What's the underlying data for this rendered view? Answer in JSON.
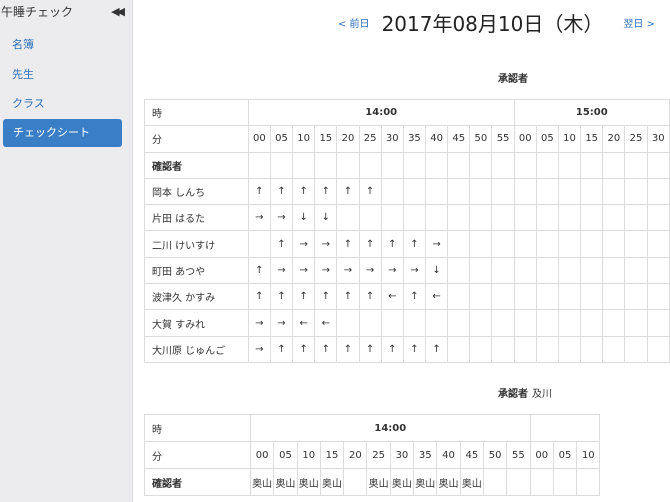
{
  "app": {
    "title": "午睡チェック"
  },
  "nav": [
    {
      "label": "名簿"
    },
    {
      "label": "先生"
    },
    {
      "label": "クラス"
    },
    {
      "label": "チェックシート",
      "active": true
    }
  ],
  "date_nav": {
    "prev": "< 前日",
    "title": "2017年08月10日（木）",
    "next": "翌日 >"
  },
  "sheets": [
    {
      "approver_label": "承認者",
      "approver_name": "",
      "row_label_time": "時",
      "row_label_minute": "分",
      "row_label_confirmer": "確認者",
      "hours": [
        "14:00",
        "15:00"
      ],
      "minutes": [
        "00",
        "05",
        "10",
        "15",
        "20",
        "25",
        "30",
        "35",
        "40",
        "45",
        "50",
        "55",
        "00",
        "05",
        "10",
        "15",
        "20",
        "25",
        "30"
      ],
      "confirmers": [],
      "children": [
        {
          "name": "岡本 しんち",
          "marks": [
            "↑",
            "↑",
            "↑",
            "↑",
            "↑",
            "↑",
            "",
            "",
            "",
            "",
            "",
            ""
          ]
        },
        {
          "name": "片田 はるた",
          "marks": [
            "→",
            "→",
            "↓",
            "↓",
            "",
            "",
            "",
            "",
            "",
            "",
            "",
            ""
          ]
        },
        {
          "name": "二川 けいすけ",
          "marks": [
            "",
            "↑",
            "→",
            "→",
            "↑",
            "↑",
            "↑",
            "↑",
            "→",
            "",
            "",
            ""
          ]
        },
        {
          "name": "町田 あつや",
          "marks": [
            "↑",
            "→",
            "→",
            "→",
            "→",
            "→",
            "→",
            "→",
            "↓",
            "",
            "",
            ""
          ]
        },
        {
          "name": "波津久 かすみ",
          "marks": [
            "↑",
            "↑",
            "↑",
            "↑",
            "↑",
            "↑",
            "←",
            "↑",
            "←",
            "",
            "",
            ""
          ]
        },
        {
          "name": "大賀 すみれ",
          "marks": [
            "→",
            "→",
            "←",
            "←",
            "",
            "",
            "",
            "",
            "",
            "",
            "",
            ""
          ]
        },
        {
          "name": "大川原 じゅんご",
          "marks": [
            "→",
            "↑",
            "↑",
            "↑",
            "↑",
            "↑",
            "↑",
            "↑",
            "↑",
            "",
            "",
            ""
          ]
        }
      ]
    },
    {
      "approver_label": "承認者",
      "approver_name": "及川",
      "row_label_time": "時",
      "row_label_minute": "分",
      "row_label_confirmer": "確認者",
      "hours": [
        "14:00"
      ],
      "minutes": [
        "00",
        "05",
        "10",
        "15",
        "20",
        "25",
        "30",
        "35",
        "40",
        "45",
        "50",
        "55",
        "00",
        "05",
        "10"
      ],
      "confirmers": [
        "奥山",
        "奥山",
        "奥山",
        "奥山",
        "",
        "奥山",
        "奥山",
        "奥山",
        "奥山",
        "奥山",
        "",
        "",
        "",
        "",
        ""
      ]
    }
  ]
}
